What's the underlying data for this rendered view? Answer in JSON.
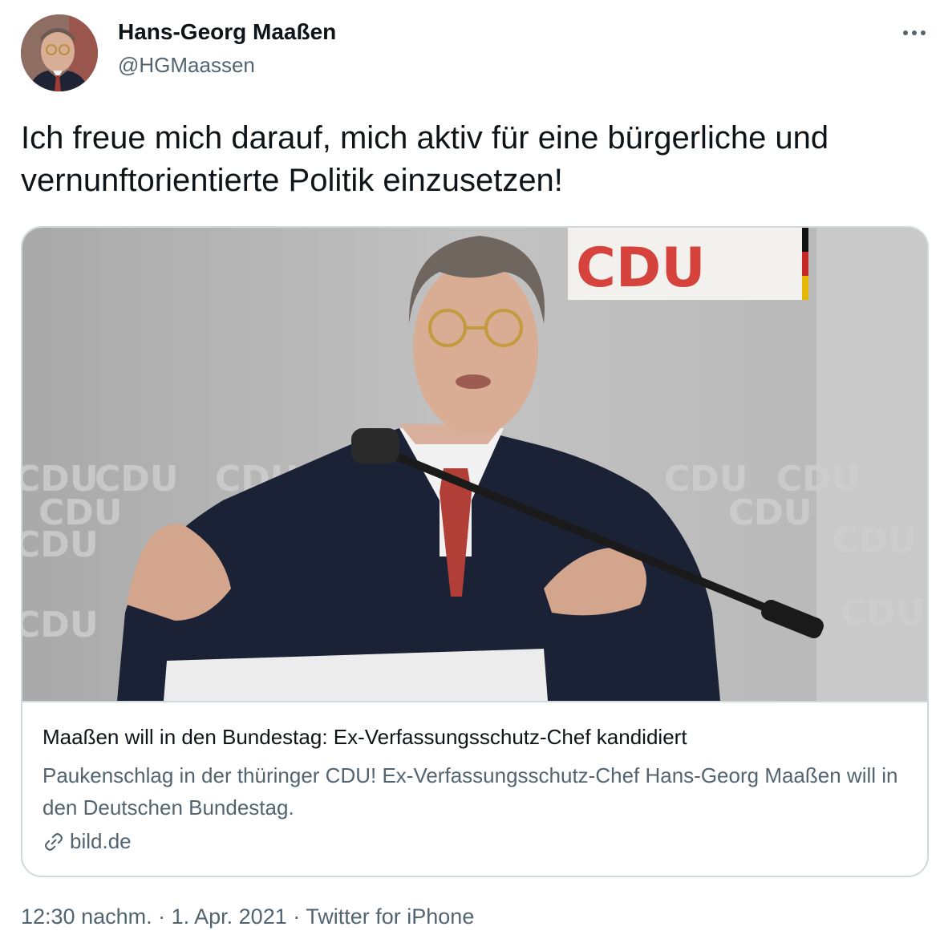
{
  "tweet": {
    "display_name": "Hans-Georg Maaßen",
    "handle": "@HGMaassen",
    "text": "Ich freue mich darauf, mich aktiv für eine bürgerliche und vernunftorientierte Politik einzusetzen!",
    "more_icon": "more-horizontal-icon"
  },
  "card": {
    "image_banner_text": "CDU",
    "image_backdrop_text": "CDU",
    "title": "Maaßen will in den Bundestag: Ex-Verfassungsschutz-Chef kandidiert",
    "description": "Paukenschlag in der thüringer CDU! Ex-Verfassungsschutz-Chef Hans-Georg Maaßen will in den Deutschen Bundestag.",
    "source": "bild.de",
    "source_icon": "link-icon"
  },
  "meta": {
    "time": "12:30 nachm.",
    "separator": " · ",
    "date": "1. Apr. 2021",
    "client": "Twitter for iPhone"
  },
  "colors": {
    "text_primary": "#0f1419",
    "text_secondary": "#536471",
    "border": "#cfd9de",
    "cdu_red": "#d6423c"
  }
}
